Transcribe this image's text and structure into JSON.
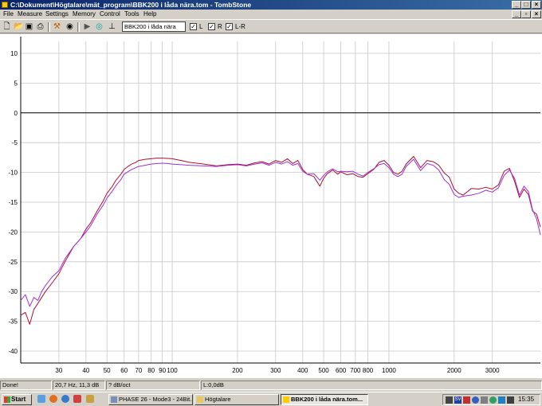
{
  "window": {
    "title": "C:\\Dokument\\Högtalare\\mät_program\\BBK200 i låda nära.tom - TombStone",
    "buttons": {
      "minimize": "_",
      "maximize": "□",
      "close": "×"
    },
    "mdi_buttons": {
      "minimize": "_",
      "restore": "▫",
      "close": "×"
    }
  },
  "menu": [
    "File",
    "Measure",
    "Settings",
    "Memory",
    "Control",
    "Tools",
    "Help"
  ],
  "toolbar": {
    "icons": [
      "new-file-icon",
      "open-icon",
      "save-icon",
      "print-icon",
      "probe-icon",
      "record-icon",
      "play-icon",
      "sweep-icon",
      "antenna-icon"
    ],
    "measurement_select": "BBK200 i låda nära",
    "checks": [
      {
        "label": "L",
        "checked": true
      },
      {
        "label": "R",
        "checked": true
      },
      {
        "label": "L-R",
        "checked": true
      }
    ]
  },
  "chart_data": {
    "type": "line",
    "title": "",
    "xlabel": "",
    "ylabel": "",
    "xscale": "log",
    "xlim": [
      20,
      5000
    ],
    "ylim": [
      -42,
      12
    ],
    "y_ticks": [
      10,
      5,
      0,
      -5,
      -10,
      -15,
      -20,
      -25,
      -30,
      -35,
      -40
    ],
    "x_ticks": [
      {
        "value": 30,
        "label": "30"
      },
      {
        "value": 40,
        "label": "40"
      },
      {
        "value": 50,
        "label": "50"
      },
      {
        "value": 60,
        "label": "60"
      },
      {
        "value": 70,
        "label": "70"
      },
      {
        "value": 80,
        "label": "80"
      },
      {
        "value": 90,
        "label": "90"
      },
      {
        "value": 100,
        "label": "100"
      },
      {
        "value": 200,
        "label": "200"
      },
      {
        "value": 300,
        "label": "300"
      },
      {
        "value": 400,
        "label": "400"
      },
      {
        "value": 500,
        "label": "500"
      },
      {
        "value": 600,
        "label": "600"
      },
      {
        "value": 700,
        "label": "700"
      },
      {
        "value": 800,
        "label": "800"
      },
      {
        "value": 1000,
        "label": "1000"
      },
      {
        "value": 2000,
        "label": "2000"
      },
      {
        "value": 3000,
        "label": "3000"
      }
    ],
    "zero_line": true,
    "grid": true,
    "legend": "none",
    "series": [
      {
        "color": "#b01030",
        "x": [
          20,
          21,
          22,
          23,
          24,
          25,
          26,
          28,
          30,
          32,
          35,
          38,
          40,
          42,
          45,
          48,
          50,
          53,
          55,
          58,
          60,
          63,
          65,
          68,
          70,
          75,
          80,
          85,
          90,
          95,
          100,
          110,
          120,
          140,
          160,
          180,
          200,
          220,
          240,
          260,
          280,
          300,
          320,
          340,
          360,
          380,
          400,
          420,
          450,
          480,
          500,
          520,
          550,
          580,
          600,
          640,
          680,
          720,
          760,
          800,
          850,
          900,
          950,
          1000,
          1050,
          1100,
          1150,
          1200,
          1300,
          1400,
          1500,
          1600,
          1700,
          1800,
          1900,
          2000,
          2100,
          2200,
          2400,
          2600,
          2800,
          3000,
          3200,
          3400,
          3600,
          3800,
          4000,
          4200,
          4400,
          4600,
          4800,
          5000
        ],
        "y": [
          -34,
          -33.5,
          -35.5,
          -33,
          -32,
          -31,
          -30,
          -28.5,
          -27,
          -25,
          -22.5,
          -21,
          -19.5,
          -18.5,
          -16.5,
          -14.8,
          -13.5,
          -12.3,
          -11.3,
          -10.3,
          -9.5,
          -8.9,
          -8.6,
          -8.3,
          -8.0,
          -7.8,
          -7.7,
          -7.6,
          -7.6,
          -7.65,
          -7.7,
          -8.0,
          -8.3,
          -8.6,
          -8.9,
          -8.7,
          -8.6,
          -8.8,
          -8.4,
          -8.2,
          -8.6,
          -8.0,
          -8.3,
          -7.7,
          -8.5,
          -8.0,
          -9.5,
          -10.3,
          -10.7,
          -12.3,
          -11.0,
          -10.2,
          -9.6,
          -10.3,
          -9.9,
          -10.4,
          -10.2,
          -10.7,
          -10.8,
          -10.2,
          -9.5,
          -8.3,
          -8.0,
          -8.8,
          -10.0,
          -10.3,
          -9.8,
          -8.6,
          -7.3,
          -9.2,
          -8.0,
          -8.2,
          -8.8,
          -10.1,
          -10.8,
          -12.8,
          -13.5,
          -13.8,
          -12.7,
          -12.8,
          -12.5,
          -12.8,
          -12.1,
          -9.8,
          -9.3,
          -11.5,
          -14.2,
          -12.8,
          -13.7,
          -16.5,
          -17.0,
          -19.2
        ]
      },
      {
        "color": "#a030d8",
        "x": [
          20,
          21,
          22,
          23,
          24,
          25,
          26,
          28,
          30,
          32,
          35,
          38,
          40,
          42,
          45,
          48,
          50,
          53,
          55,
          58,
          60,
          63,
          65,
          68,
          70,
          75,
          80,
          85,
          90,
          95,
          100,
          110,
          120,
          140,
          160,
          180,
          200,
          220,
          240,
          260,
          280,
          300,
          320,
          340,
          360,
          380,
          400,
          420,
          450,
          480,
          500,
          520,
          550,
          580,
          600,
          640,
          680,
          720,
          760,
          800,
          850,
          900,
          950,
          1000,
          1050,
          1100,
          1150,
          1200,
          1300,
          1400,
          1500,
          1600,
          1700,
          1800,
          1900,
          2000,
          2100,
          2200,
          2400,
          2600,
          2800,
          3000,
          3200,
          3400,
          3600,
          3800,
          4000,
          4200,
          4400,
          4600,
          4800,
          5000
        ],
        "y": [
          -31.5,
          -30.5,
          -32.5,
          -31,
          -31.5,
          -30,
          -29,
          -27.5,
          -26.5,
          -24.5,
          -22.5,
          -21,
          -20,
          -19,
          -17,
          -15.5,
          -14.3,
          -13.1,
          -12.2,
          -11.2,
          -10.3,
          -9.8,
          -9.5,
          -9.2,
          -9.0,
          -8.8,
          -8.6,
          -8.5,
          -8.45,
          -8.5,
          -8.6,
          -8.7,
          -8.8,
          -8.9,
          -9.0,
          -8.8,
          -8.7,
          -8.9,
          -8.6,
          -8.4,
          -8.8,
          -8.3,
          -8.6,
          -8.2,
          -8.8,
          -8.5,
          -9.8,
          -10.3,
          -10.2,
          -11.3,
          -10.5,
          -9.9,
          -9.4,
          -9.9,
          -9.8,
          -9.9,
          -9.8,
          -10.3,
          -10.6,
          -10.0,
          -9.4,
          -8.7,
          -8.5,
          -9.2,
          -10.3,
          -10.7,
          -10.3,
          -9.0,
          -7.8,
          -9.7,
          -8.5,
          -8.8,
          -9.6,
          -11.2,
          -12.0,
          -13.7,
          -14.2,
          -14.0,
          -13.8,
          -13.5,
          -13.0,
          -13.3,
          -12.6,
          -10.5,
          -9.6,
          -11.0,
          -13.8,
          -12.3,
          -13.2,
          -16.3,
          -17.8,
          -20.5
        ]
      }
    ]
  },
  "status": {
    "state": "Done!",
    "cursor": "20,7 Hz, 11,3 dB",
    "smoothing": "? dB/oct",
    "level": "L:0,0dB"
  },
  "taskbar": {
    "start": "Start",
    "tasks": [
      {
        "label": "PHASE 26 - Mode3 - 24Bit...",
        "active": false
      },
      {
        "label": "Högtalare",
        "active": false
      },
      {
        "label": "BBK200 i låda nära.tom...",
        "active": true
      }
    ],
    "tray_lang": "SV",
    "clock": "15:35"
  }
}
